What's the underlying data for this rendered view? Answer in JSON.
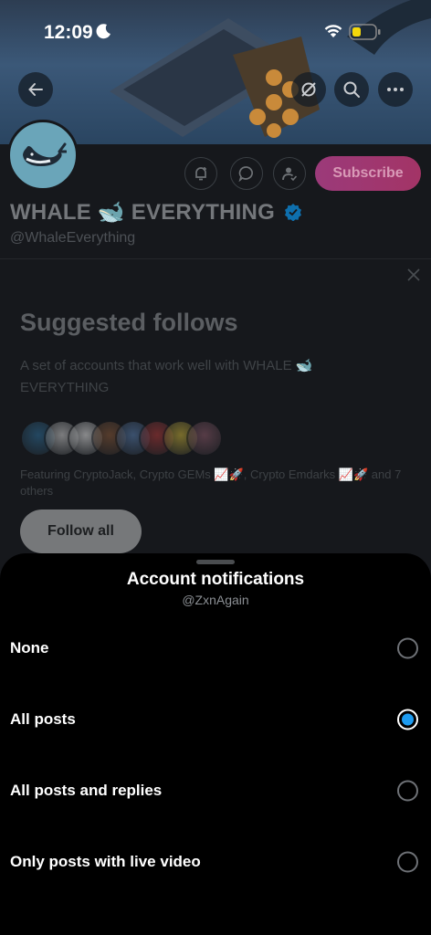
{
  "status_bar": {
    "time": "12:09"
  },
  "profile": {
    "name": "WHALE 🐋 EVERYTHING",
    "handle": "@WhaleEverything",
    "subscribe_label": "Subscribe"
  },
  "suggested": {
    "title": "Suggested follows",
    "description": "A set of accounts that work well with WHALE 🐋 EVERYTHING",
    "featuring": "Featuring CryptoJack, Crypto GEMs 📈🚀, Crypto Emdarks 📈🚀 and 7 others",
    "follow_all_label": "Follow all",
    "avatar_colors": [
      "#2f6f9a",
      "#cfcfcf",
      "#e6e6e6",
      "#8a5a3a",
      "#5a7fb0",
      "#b03a3a",
      "#c8b13a",
      "#8c5a6a"
    ]
  },
  "sheet": {
    "title": "Account notifications",
    "subtitle": "@ZxnAgain",
    "options": [
      {
        "label": "None",
        "selected": false
      },
      {
        "label": "All posts",
        "selected": true
      },
      {
        "label": "All posts and replies",
        "selected": false
      },
      {
        "label": "Only posts with live video",
        "selected": false
      }
    ]
  },
  "colors": {
    "accent": "#1d9bf0",
    "subscribe": "#a33466"
  }
}
